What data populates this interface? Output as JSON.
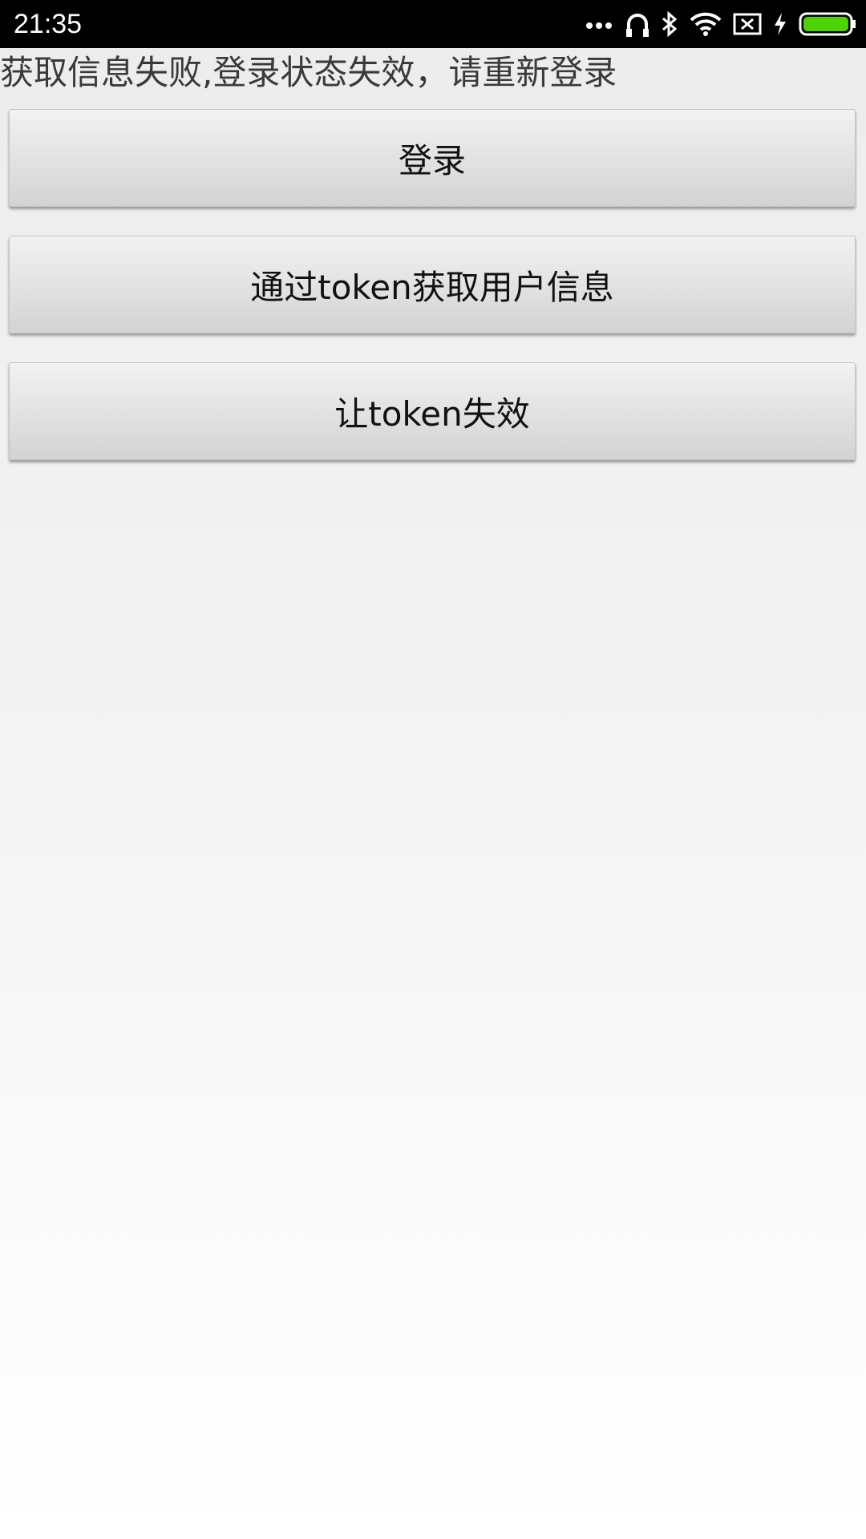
{
  "status_bar": {
    "time": "21:35",
    "icons": [
      "more-dots-icon",
      "headphones-icon",
      "bluetooth-icon",
      "wifi-icon",
      "sim-off-icon",
      "charging-icon",
      "battery-icon"
    ],
    "battery_color": "#4cd400"
  },
  "main": {
    "message": "获取信息失败,登录状态失效，请重新登录",
    "buttons": {
      "login": "登录",
      "get_user_info": "通过token获取用户信息",
      "invalidate_token": "让token失效"
    }
  }
}
